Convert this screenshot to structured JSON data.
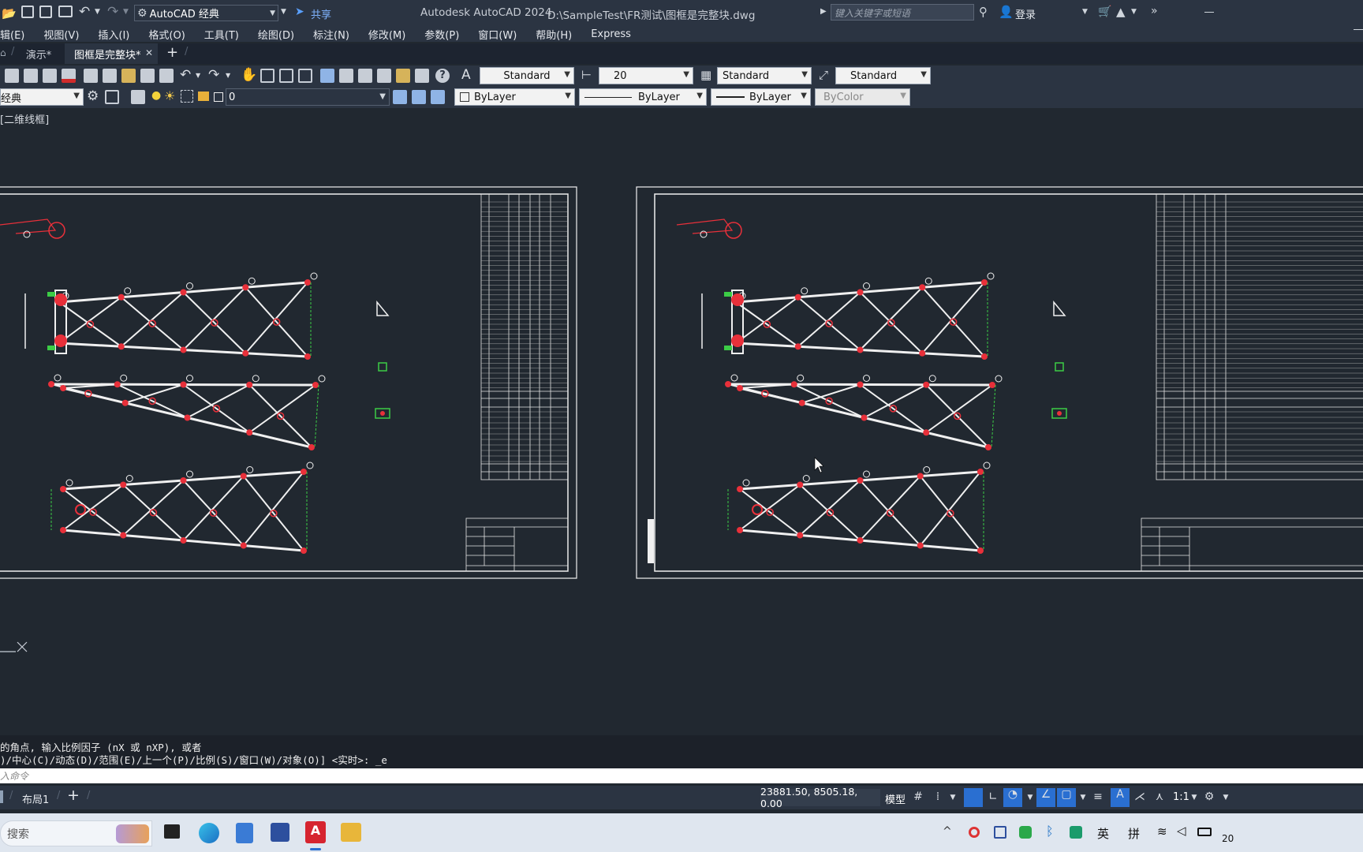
{
  "title_bar": {
    "workspace": "AutoCAD 经典",
    "share_label": "共享",
    "app_title": "Autodesk AutoCAD 2024",
    "file_path": "D:\\SampleTest\\FR测试\\图框是完整块.dwg",
    "search_placeholder": "键入关键字或短语",
    "login_label": "登录"
  },
  "menu": {
    "items": [
      "辑(E)",
      "视图(V)",
      "插入(I)",
      "格式(O)",
      "工具(T)",
      "绘图(D)",
      "标注(N)",
      "修改(M)",
      "参数(P)",
      "窗口(W)",
      "帮助(H)",
      "Express"
    ]
  },
  "tabs": {
    "items": [
      {
        "label": "演示*",
        "active": false
      },
      {
        "label": "图框是完整块*",
        "active": true
      }
    ]
  },
  "toolbar": {
    "text_style": "Standard",
    "dim_scale": "20",
    "dim_style": "Standard",
    "table_style": "Standard",
    "workspace_combo": "经典",
    "layer_name": "0",
    "color": "ByLayer",
    "linetype": "ByLayer",
    "lineweight": "ByLayer",
    "plot_style": "ByColor"
  },
  "viewport": {
    "label": "[二维线框]"
  },
  "command": {
    "line1": "的角点, 输入比例因子 (nX 或 nXP), 或者",
    "line2": ")/中心(C)/动态(D)/范围(E)/上一个(P)/比例(S)/窗口(W)/对象(O)] <实时>: _e",
    "input_placeholder": "入命令"
  },
  "status": {
    "layout_tab": "布局1",
    "coordinates": "23881.50, 8505.18, 0.00",
    "model_label": "模型",
    "scale": "1:1"
  },
  "taskbar": {
    "search_placeholder": "搜索",
    "ime_lang": "英",
    "ime_mode": "拼",
    "clock": "20"
  },
  "colors": {
    "canvas": "#212830",
    "chrome": "#2b3442",
    "drawing_line": "#f0f0f0",
    "red_marks": "#e8303a",
    "green_marks": "#3ccc46",
    "accent_blue": "#2a6fd1"
  }
}
